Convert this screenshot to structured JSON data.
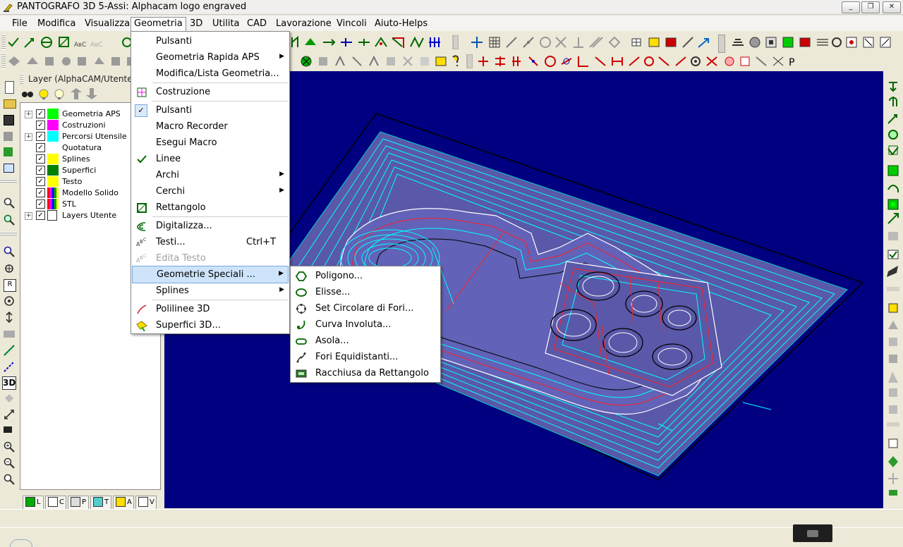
{
  "window": {
    "title": "PANTOGRAFO 3D 5-Assi: Alphacam logo engraved",
    "controls": [
      "_",
      "❐",
      "✕"
    ]
  },
  "menubar": {
    "items": [
      "File",
      "Modifica",
      "Visualizza",
      "Geometria",
      "3D",
      "Utilita",
      "CAD",
      "Lavorazione",
      "Vincoli",
      "Aiuto-Helps"
    ]
  },
  "layer_panel": {
    "title": "Layer (AlphaCAM/Utente",
    "layers": [
      {
        "label": "Geometria APS",
        "color": "#00ff00",
        "expandable": true
      },
      {
        "label": "Costruzioni",
        "color": "#ff00ff",
        "expandable": false
      },
      {
        "label": "Percorsi Utensile",
        "color": "#00ffff",
        "expandable": true
      },
      {
        "label": "Quotatura",
        "color": "#ffffff",
        "expandable": false
      },
      {
        "label": "Splines",
        "color": "#ffff00",
        "expandable": false
      },
      {
        "label": "Superfici",
        "color": "#008000",
        "expandable": false
      },
      {
        "label": "Testo",
        "color": "#ffff00",
        "expandable": false
      },
      {
        "label": "Modello Solido",
        "color": "striped",
        "expandable": false
      },
      {
        "label": "STL",
        "color": "striped",
        "expandable": false
      },
      {
        "label": "Layers Utente",
        "color": "user",
        "expandable": true
      }
    ],
    "tabs": [
      "L",
      "C",
      "P",
      "T",
      "A",
      "V"
    ]
  },
  "geometria_menu": {
    "items": [
      {
        "label": "Pulsanti",
        "has_sub": false,
        "shortcut": "",
        "disabled": false,
        "icon": "none"
      },
      {
        "label": "Geometria Rapida APS",
        "has_sub": true,
        "shortcut": "",
        "disabled": false,
        "icon": "none"
      },
      {
        "label": "Modifica/Lista Geometria...",
        "has_sub": false,
        "shortcut": "",
        "disabled": false,
        "icon": "none"
      },
      {
        "label": "Costruzione",
        "has_sub": false,
        "shortcut": "",
        "disabled": false,
        "icon": "construction-icon"
      },
      {
        "label": "Pulsanti",
        "has_sub": false,
        "shortcut": "",
        "disabled": false,
        "icon": "checkbox-checked-icon"
      },
      {
        "label": "Macro Recorder",
        "has_sub": false,
        "shortcut": "",
        "disabled": false,
        "icon": "none"
      },
      {
        "label": "Esegui Macro",
        "has_sub": false,
        "shortcut": "",
        "disabled": false,
        "icon": "none"
      },
      {
        "label": "Linee",
        "has_sub": false,
        "shortcut": "",
        "disabled": false,
        "icon": "line-icon"
      },
      {
        "label": "Archi",
        "has_sub": true,
        "shortcut": "",
        "disabled": false,
        "icon": "none"
      },
      {
        "label": "Cerchi",
        "has_sub": true,
        "shortcut": "",
        "disabled": false,
        "icon": "none"
      },
      {
        "label": "Rettangolo",
        "has_sub": false,
        "shortcut": "",
        "disabled": false,
        "icon": "rectangle-icon"
      },
      {
        "label": "Digitalizza...",
        "has_sub": false,
        "shortcut": "",
        "disabled": false,
        "icon": "digitize-icon"
      },
      {
        "label": "Testi...",
        "has_sub": false,
        "shortcut": "Ctrl+T",
        "disabled": false,
        "icon": "text-icon"
      },
      {
        "label": "Edita Testo",
        "has_sub": false,
        "shortcut": "",
        "disabled": true,
        "icon": "edit-text-icon"
      },
      {
        "label": "Geometrie Speciali ...",
        "has_sub": true,
        "shortcut": "",
        "disabled": false,
        "icon": "none"
      },
      {
        "label": "Splines",
        "has_sub": true,
        "shortcut": "",
        "disabled": false,
        "icon": "none"
      },
      {
        "label": "Polilinee 3D",
        "has_sub": false,
        "shortcut": "",
        "disabled": false,
        "icon": "polyline-3d-icon"
      },
      {
        "label": "Superfici 3D...",
        "has_sub": false,
        "shortcut": "",
        "disabled": false,
        "icon": "surface-3d-icon"
      }
    ]
  },
  "special_submenu": {
    "items": [
      {
        "label": "Poligono...",
        "icon": "polygon-icon"
      },
      {
        "label": "Elisse...",
        "icon": "ellipse-icon"
      },
      {
        "label": "Set Circolare di Fori...",
        "icon": "hole-circle-icon"
      },
      {
        "label": "Curva Involuta...",
        "icon": "involute-icon"
      },
      {
        "label": "Asola...",
        "icon": "slot-icon"
      },
      {
        "label": "Fori Equidistanti...",
        "icon": "equidistant-holes-icon"
      },
      {
        "label": "Racchiusa da Rettangolo",
        "icon": "bounding-rect-icon"
      }
    ]
  },
  "colors": {
    "viewport_bg": "#000080",
    "menu_highlight": "#cde4fb",
    "toolpath_cyan": "#00ffff",
    "geometry_red": "#ff0000"
  }
}
